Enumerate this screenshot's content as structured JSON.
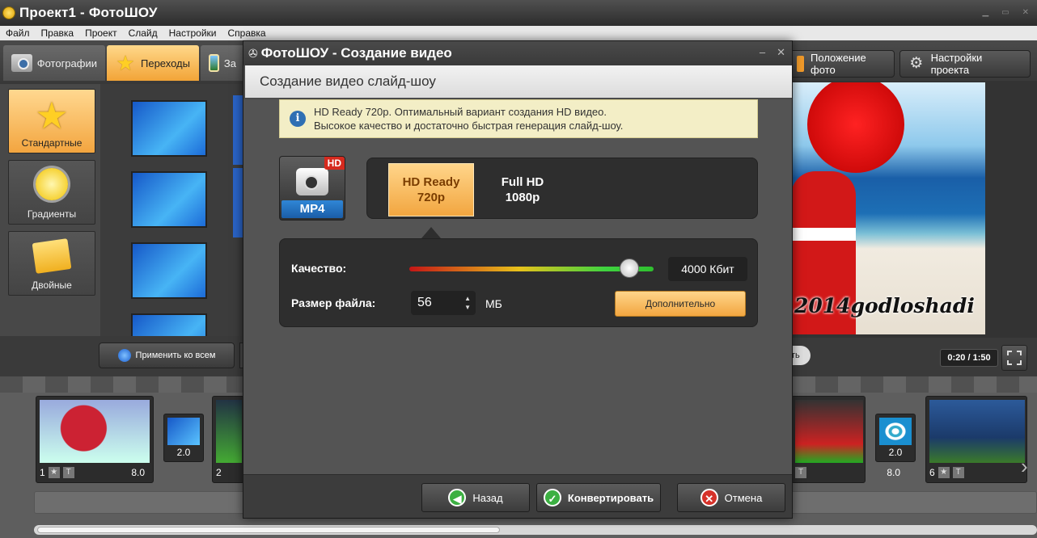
{
  "window": {
    "title": "Проект1 - ФотоШОУ"
  },
  "menu": [
    "Файл",
    "Правка",
    "Проект",
    "Слайд",
    "Настройки",
    "Справка"
  ],
  "tabs": {
    "photos": "Фотографии",
    "transitions": "Переходы",
    "third": "За"
  },
  "toolbar": {
    "photo_position": "Положение фото",
    "project_settings": "Настройки проекта"
  },
  "categories": [
    "Стандартные",
    "Градиенты",
    "Двойные"
  ],
  "apply_all": "Применить ко всем",
  "preview": {
    "watermark": "2014godloshadi",
    "time": "0:20 / 1:50",
    "play_label": "ть"
  },
  "timeline": {
    "slides": [
      {
        "num": "1",
        "dur": "8.0"
      },
      {
        "num": "2",
        "dur": ""
      },
      {
        "num": "",
        "dur": "8.0"
      },
      {
        "num": "6",
        "dur": ""
      }
    ],
    "transitions": [
      "2.0",
      "2.0"
    ]
  },
  "dialog": {
    "title": "ФотоШОУ - Создание видео",
    "subtitle": "Создание видео слайд-шоу",
    "info_line1": "HD Ready 720p. Оптимальный вариант создания HD видео.",
    "info_line2": "Высокое качество и достаточно быстрая генерация слайд-шоу.",
    "format_badge": "HD",
    "format": "MP4",
    "res_hd_line1": "HD Ready",
    "res_hd_line2": "720p",
    "res_full_line1": "Full HD",
    "res_full_line2": "1080p",
    "quality_label": "Качество:",
    "quality_level": 0.9,
    "bitrate": "4000 Кбит",
    "size_label": "Размер файла:",
    "size_value": "56",
    "size_unit": "МБ",
    "advanced": "Дополнительно",
    "back": "Назад",
    "convert": "Конвертировать",
    "cancel": "Отмена"
  }
}
